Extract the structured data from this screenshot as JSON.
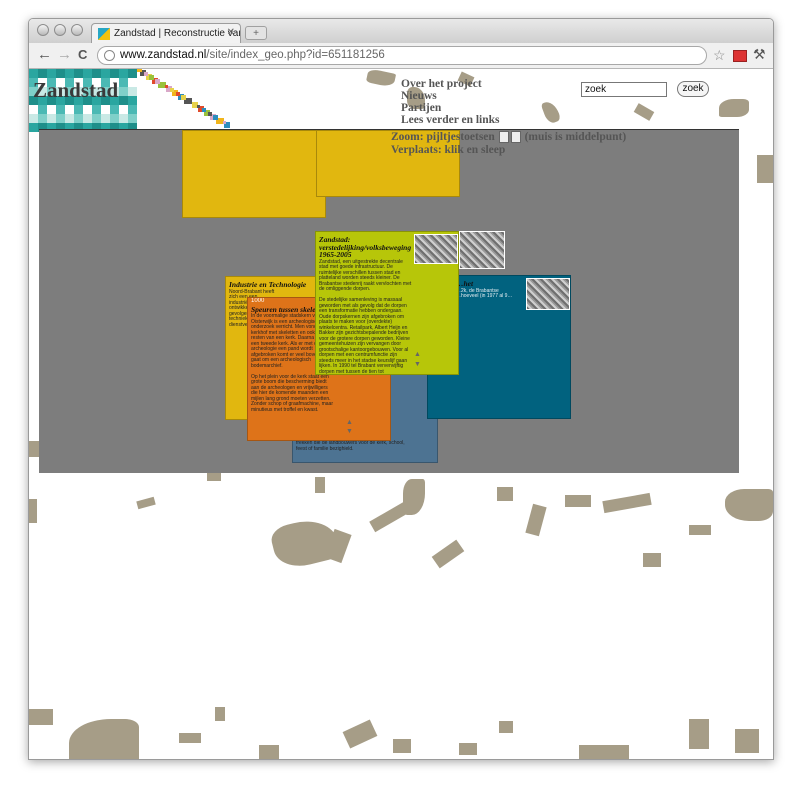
{
  "browser": {
    "tab_title": "Zandstad | Reconstructie van",
    "tab_close": "✕",
    "url_host": "www.zandstad.nl",
    "url_path": "/site/index_geo.php?id=651181256",
    "back_icon": "←",
    "forward_icon": "→",
    "reload_icon": "C"
  },
  "site": {
    "logo": "Zandstad",
    "menu": [
      "Over het project",
      "Nieuws",
      "Partijen",
      "Lees verder en links"
    ],
    "search_value": "zoek",
    "search_button": "zoek",
    "zoom_text": "Zoom: pijltjestoetsen",
    "zoom_hint": "(muis is middelpunt)",
    "move_text": "Verplaats: klik en sleep"
  },
  "panels": {
    "industrie": {
      "title": "Industrie en Technologie",
      "body": "Noord-Brabant heeft zich een een industriële regio ontwikkeld. Dit had gevolgen voor de technieken en dienstverlening."
    },
    "speuren": {
      "year": "1000",
      "title": "Speuren tussen skeletten",
      "body": "In de voormalige stadskern van Oisterwijk is een archeologisch onderzoek verricht. Men vond er een kerkhof met skeletten en ook de resten van een kerk. Daarna kwam er een tweede kerk. Als er met de archeologie een pand wordt afgebroken komt er veel boven. Het gaat om een archeologisch bodemarchief.\n\nOp het plein voor de kerk staat een grote boom die bescherming biedt aan de archeologen en vrijwilligers die hier de komende maanden een mijlen lang grond moeten verzetten. Zonder schop of graafmachine, maar minutieus met troffel en kwast."
    },
    "verstedelijking": {
      "title": "Zandstad: verstedelijking/volksbeweging 1965-2005",
      "body": "Zandstad, een uitgestrekte decentrale stad met goede infrastructuur. De ruimtelijke verschillen tussen stad en platteland worden steeds kleiner. De Brabantse stedenrij raakt vervlochten met de omliggende dorpen.\n\nDe stedelijke samenleving is massaal geworden met als gevolg dat de dorpen een transformatie hebben ondergaan. Oude dorpskernen zijn afgebroken om plaats te maken voor (overdekte) winkelcentra. Retailpark, Albert Heijn en Bakker zijn gezichtsbepalende bedrijven voor de grotere dorpen geworden. Kleine gemeentehuizen zijn vervangen door grootschalige kantoorgebouwen. Voor al dorpen met een centrumfunctie zijn steeds meer in het stadse keurslijf gaan lijken. In 1990 tel Brabant vervenvijftig dorpen met tussen de tien tot vijftigduizend inwoners."
    },
    "blauw": {
      "title": "…het",
      "body": "…2k, de Brabantse\n…hoeveel (in 1977 al 9…"
    },
    "grijsblauw": {
      "body": "frekken die de landbouwers voor de kerk, school, feest of familie bezighield."
    },
    "arrows": {
      "up": "▲",
      "down": "▼"
    }
  },
  "colors": {
    "stage": "#7d7d7d",
    "yellow": "#e1b70f",
    "orange": "#de7319",
    "lime": "#b7c609",
    "blue": "#01627f",
    "slate": "#4d7392",
    "silhouette": "#a69d87"
  },
  "icons": {
    "star": "☆",
    "wrench": "🔧"
  }
}
